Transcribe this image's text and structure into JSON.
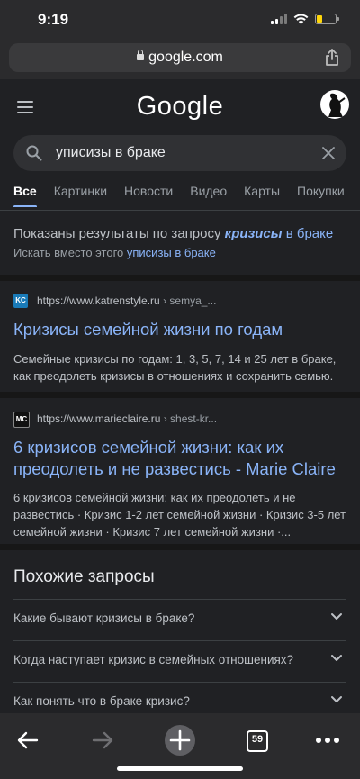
{
  "status": {
    "time": "9:19",
    "battery_level": 0.3
  },
  "browser": {
    "url": "google.com"
  },
  "header": {
    "logo": "Google"
  },
  "search": {
    "query": "уписизы в браке"
  },
  "tabs": [
    {
      "label": "Все",
      "active": true
    },
    {
      "label": "Картинки"
    },
    {
      "label": "Новости"
    },
    {
      "label": "Видео"
    },
    {
      "label": "Карты"
    },
    {
      "label": "Покупки"
    }
  ],
  "correction": {
    "prefix": "Показаны результаты по запросу",
    "corrected_word": "кризисы",
    "corrected_rest": "в браке",
    "instead_prefix": "Искать вместо этого",
    "original_query": "уписизы в браке"
  },
  "results": [
    {
      "favicon": "KC",
      "favicon_color": "#1a7bb8",
      "site": "https://www.katrenstyle.ru",
      "path": "› semya_...",
      "title": "Кризисы семейной жизни по годам",
      "snippet": "Семейные кризисы по годам: 1, 3, 5, 7, 14 и 25 лет в браке, как преодолеть кризисы в отношениях и сохранить семью."
    },
    {
      "favicon": "MC",
      "favicon_color": "#111111",
      "site": "https://www.marieclaire.ru",
      "path": "› shest-kr...",
      "title": "6 кризисов семейной жизни: как их преодолеть и не развестись - Marie Claire",
      "snippet": "6 кризисов семейной жизни: как их преодолеть и не развестись · Кризис 1-2 лет семейной жизни · Кризис 3-5 лет семейной жизни · Кризис 7 лет семейной жизни ·..."
    }
  ],
  "related": {
    "title": "Похожие запросы",
    "items": [
      "Какие бывают кризисы в браке?",
      "Когда наступает кризис в семейных отношениях?",
      "Как понять что в браке кризис?"
    ]
  },
  "toolbar": {
    "tab_count": "59"
  }
}
